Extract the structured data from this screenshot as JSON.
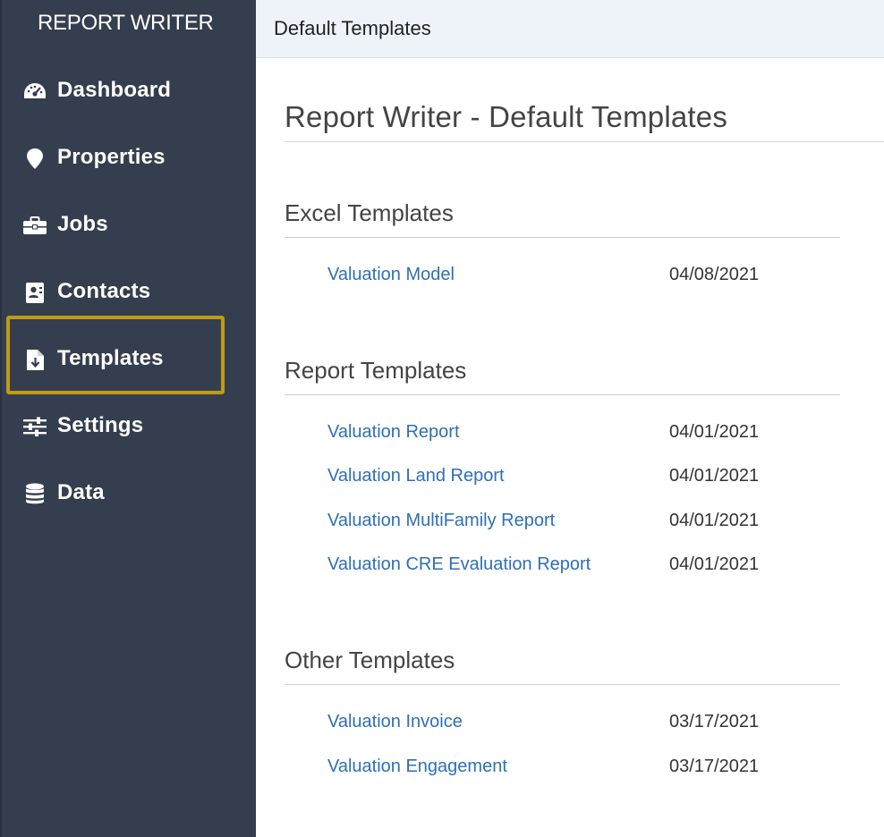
{
  "app": {
    "title": "REPORT WRITER"
  },
  "sidebar": {
    "items": [
      {
        "label": "Dashboard",
        "icon": "dashboard-icon"
      },
      {
        "label": "Properties",
        "icon": "map-pin-icon"
      },
      {
        "label": "Jobs",
        "icon": "briefcase-icon"
      },
      {
        "label": "Contacts",
        "icon": "contact-card-icon"
      },
      {
        "label": "Templates",
        "icon": "file-download-icon",
        "active": true
      },
      {
        "label": "Settings",
        "icon": "sliders-icon"
      },
      {
        "label": "Data",
        "icon": "database-icon"
      }
    ]
  },
  "topbar": {
    "title": "Default Templates"
  },
  "page": {
    "title": "Report Writer - Default Templates"
  },
  "sections": [
    {
      "title": "Excel Templates",
      "items": [
        {
          "name": "Valuation Model",
          "date": "04/08/2021"
        }
      ]
    },
    {
      "title": "Report Templates",
      "items": [
        {
          "name": "Valuation Report",
          "date": "04/01/2021"
        },
        {
          "name": "Valuation Land Report",
          "date": "04/01/2021"
        },
        {
          "name": "Valuation MultiFamily Report",
          "date": "04/01/2021"
        },
        {
          "name": "Valuation CRE Evaluation Report",
          "date": "04/01/2021"
        }
      ]
    },
    {
      "title": "Other Templates",
      "items": [
        {
          "name": "Valuation Invoice",
          "date": "03/17/2021"
        },
        {
          "name": "Valuation Engagement",
          "date": "03/17/2021"
        }
      ]
    }
  ],
  "colors": {
    "sidebar_bg": "#343e4f",
    "highlight_border": "#c29a13",
    "link": "#2e6fb6",
    "topbar_bg": "#edf3f8"
  }
}
